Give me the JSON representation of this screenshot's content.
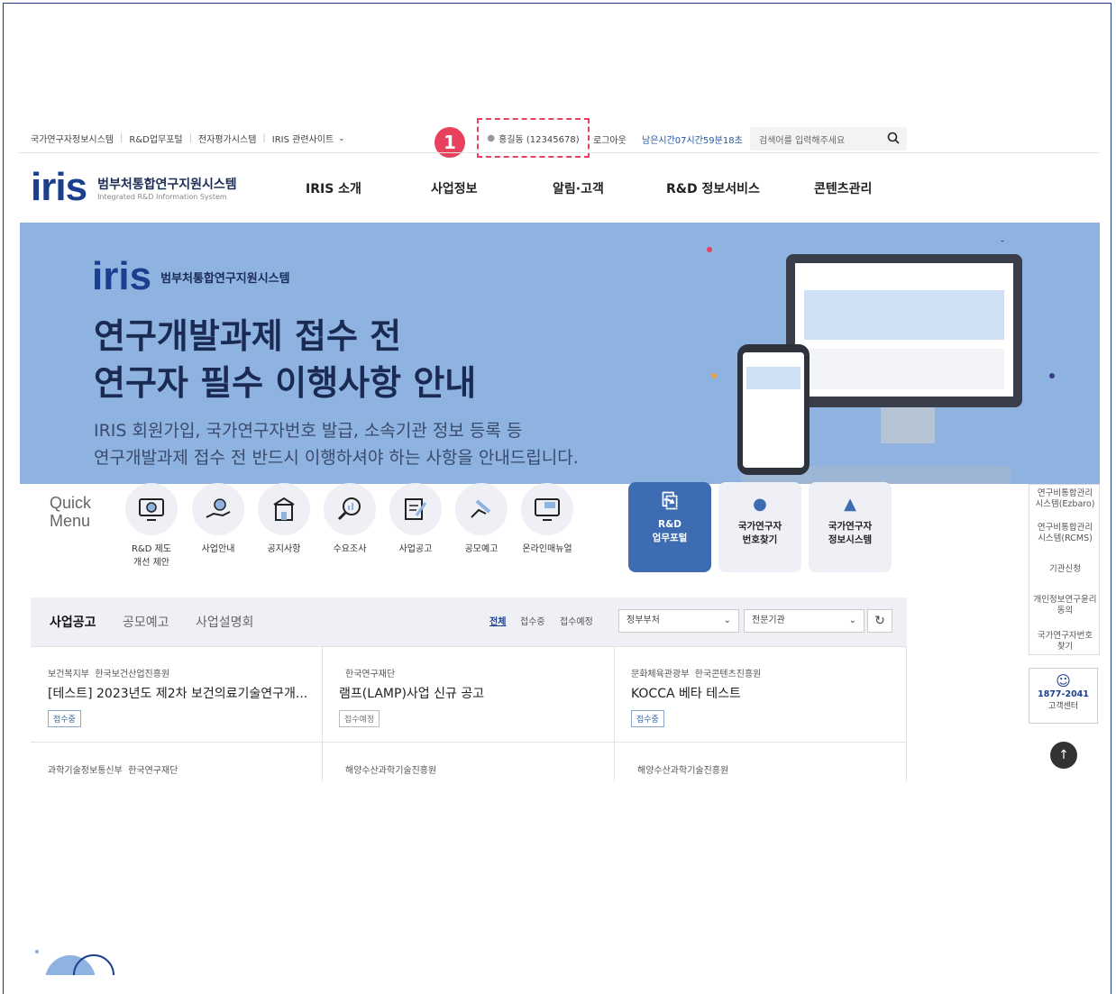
{
  "util": {
    "links": [
      "국가연구자정보시스템",
      "R&D업무포털",
      "전자평가시스템",
      "IRIS 관련사이트"
    ],
    "marker": "1",
    "user": "홍길동 (12345678)",
    "logout": "로그아웃",
    "timer": "남은시간07시간59분18초",
    "search_placeholder": "검색어를 입력해주세요"
  },
  "logo": {
    "word_a": "iri",
    "word_b": "s",
    "title": "범부처통합연구지원시스템",
    "subtitle": "Integrated R&D Information System"
  },
  "nav": [
    "IRIS 소개",
    "사업정보",
    "알림·고객",
    "R&D 정보서비스",
    "콘텐츠관리"
  ],
  "banner": {
    "logo_title": "범부처통합연구지원시스템",
    "logo_sub": "Integrated R&D Information System",
    "title_1": "연구개발과제 접수 전",
    "title_2": "연구자 필수 이행사항 안내",
    "sub_1": "IRIS 회원가입, 국가연구자번호 발급, 소속기관 정보 등록 등",
    "sub_2": "연구개발과제 접수 전 반드시 이행하셔야 하는 사항을 안내드립니다."
  },
  "quick": {
    "title_1": "Quick",
    "title_2": "Menu",
    "items": [
      {
        "label": "R&D 제도 개선 제안",
        "icon": "monitor-gear-icon"
      },
      {
        "label": "사업안내",
        "icon": "hand-idea-icon"
      },
      {
        "label": "공지사항",
        "icon": "building-icon"
      },
      {
        "label": "수요조사",
        "icon": "search-chart-icon"
      },
      {
        "label": "사업공고",
        "icon": "edit-document-icon"
      },
      {
        "label": "공모예고",
        "icon": "pen-hand-icon"
      },
      {
        "label": "온라인매뉴얼",
        "icon": "monitor-chat-icon"
      }
    ],
    "cards": [
      {
        "line1": "R&D",
        "line2": "업무포털"
      },
      {
        "line1": "국가연구자",
        "line2": "번호찾기"
      },
      {
        "line1": "국가연구자",
        "line2": "정보시스템"
      }
    ]
  },
  "notice": {
    "tabs": [
      "사업공고",
      "공모예고",
      "사업설명회"
    ],
    "filters": [
      "전체",
      "접수중",
      "접수예정"
    ],
    "select_1": "정부부처",
    "select_2": "전문기관",
    "rows": [
      {
        "ministry": "보건복지부",
        "agency": "한국보건산업진흥원",
        "title": "[테스트] 2023년도 제2차 보건의료기술연구개...",
        "status": "접수중"
      },
      {
        "ministry": "",
        "agency": "한국연구재단",
        "title": "램프(LAMP)사업 신규 공고",
        "status": "접수예정"
      },
      {
        "ministry": "문화체육관광부",
        "agency": "한국콘텐츠진흥원",
        "title": "KOCCA 베타 테스트",
        "status": "접수중"
      },
      {
        "ministry": "과학기술정보통신부",
        "agency": "한국연구재단",
        "title": "",
        "status": ""
      },
      {
        "ministry": "",
        "agency": "해양수산과학기술진흥원",
        "title": "",
        "status": ""
      },
      {
        "ministry": "",
        "agency": "해양수산과학기술진흥원",
        "title": "",
        "status": ""
      }
    ]
  },
  "rail": {
    "items": [
      "연구비통합관리\n시스템(Ezbaro)",
      "연구비통합관리\n시스템(RCMS)",
      "기관신청",
      "개인정보연구윤리\n동의",
      "국가연구자번호\n찾기"
    ],
    "phone": "1877-2041",
    "cs_label": "고객센터"
  }
}
